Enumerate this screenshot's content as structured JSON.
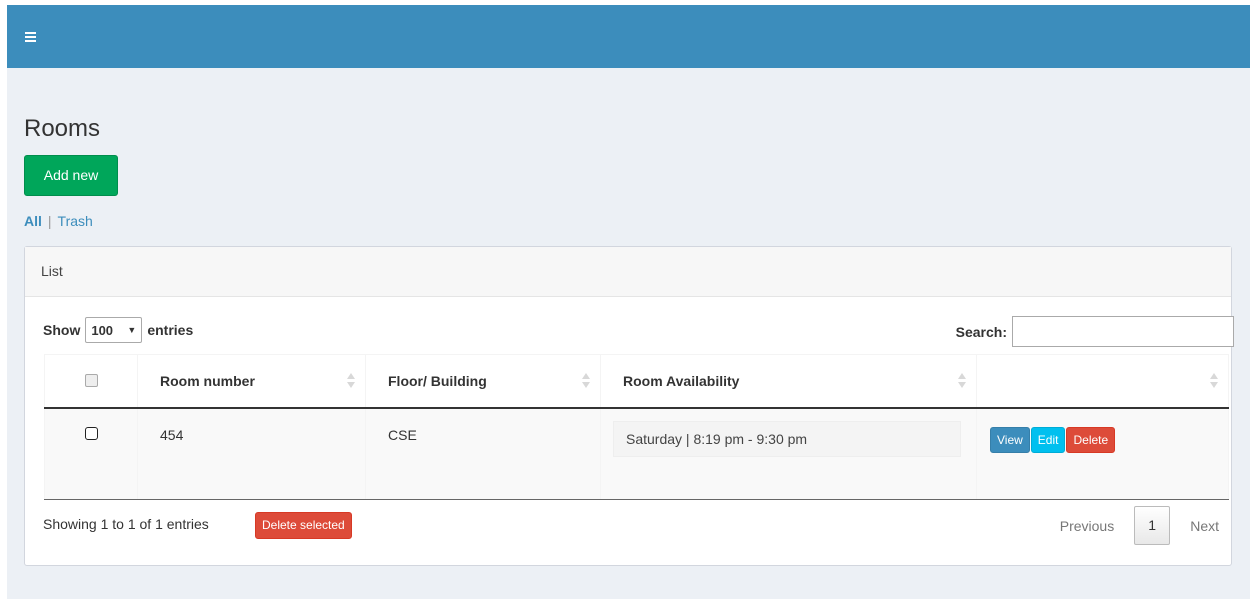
{
  "header": {
    "menu_icon": "hamburger-icon"
  },
  "page": {
    "title": "Rooms",
    "add_button": "Add new",
    "filters": {
      "all": "All",
      "separator": "|",
      "trash": "Trash"
    }
  },
  "panel": {
    "title": "List",
    "length": {
      "show": "Show",
      "value": "100",
      "entries": "entries"
    },
    "search": {
      "label": "Search:",
      "value": "",
      "placeholder": ""
    },
    "columns": [
      "Room number",
      "Floor/ Building",
      "Room Availability",
      ""
    ],
    "rows": [
      {
        "room_number": "454",
        "floor_building": "CSE",
        "availability": "Saturday | 8:19 pm - 9:30 pm",
        "actions": {
          "view": "View",
          "edit": "Edit",
          "delete": "Delete"
        }
      }
    ],
    "footer": {
      "info": "Showing 1 to 1 of 1 entries",
      "delete_selected": "Delete selected",
      "pagination": {
        "previous": "Previous",
        "current": "1",
        "next": "Next"
      }
    }
  },
  "colors": {
    "topbar": "#3c8dbc",
    "add_button": "#00a65a",
    "view_button": "#3c8dbc",
    "edit_button": "#00c0ef",
    "delete_button": "#dd4b39"
  }
}
